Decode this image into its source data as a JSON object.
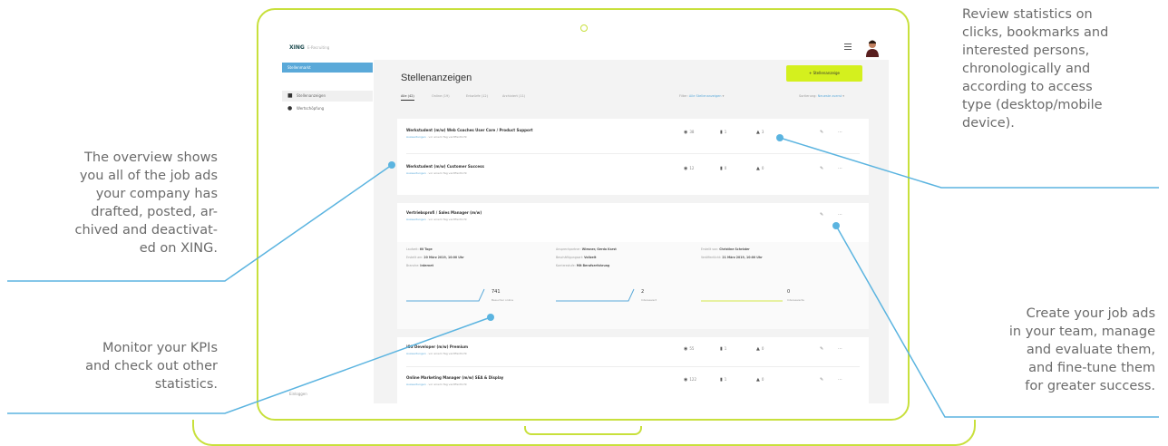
{
  "callouts": {
    "overview": [
      "The overview shows",
      "you all of the job ads",
      "your company has",
      "drafted, posted, ar-",
      "chived and deactivat-",
      "ed on XING."
    ],
    "kpis": [
      "Monitor your KPIs",
      "and check out other",
      "statistics."
    ],
    "statistics": [
      "Review statistics on",
      "clicks, bookmarks and",
      "interested persons,",
      "chronologically and",
      "according to access",
      "type (desktop/mobile",
      "device)."
    ],
    "create": [
      "Create your job ads",
      "in your team, manage",
      "and evaluate them,",
      "and fine-tune them",
      "for greater success."
    ]
  },
  "app": {
    "logo": "XING",
    "logo_sub": "E-Recruiting",
    "page_title": "Stellenanzeigen",
    "post_button": "+ Stellenanzeige",
    "sidebar": {
      "header": "Stellenmarkt",
      "items": [
        {
          "label": "Stellenanzeigen",
          "icon": "briefcase-icon"
        },
        {
          "label": "Wertschöpfung",
          "icon": "gear-icon"
        }
      ],
      "bottom": "Einloggen"
    },
    "tabs": [
      "Alle (42)",
      "Online (19)",
      "Entwürfe (12)",
      "Archiviert (11)"
    ],
    "filter_label": "Filter:",
    "filter_value": "Alle Stellenanzeigen",
    "sort_label": "Sortierung:",
    "sort_value": "Neueste zuerst",
    "jobs_top": [
      {
        "title": "Werkstudent (m/w) Web Coaches User Care / Product Support",
        "sub_link": "Auswertungen",
        "sub": " · vor einem Tag veröffentlicht",
        "views": "38",
        "bookmarks": "1",
        "interested": "3"
      },
      {
        "title": "Werkstudent (m/w) Customer Success",
        "sub_link": "Auswertungen",
        "sub": " · vor einem Tag veröffentlicht",
        "views": "12",
        "bookmarks": "0",
        "interested": "0"
      }
    ],
    "expanded_job": {
      "title": "Vertriebsprofi / Sales Manager (m/w)",
      "sub_link": "Auswertungen",
      "sub": " · vor einem Tag veröffentlicht",
      "details": [
        {
          "label": "Laufzeit:",
          "value": "60 Tage"
        },
        {
          "label": "Ansprechpartner:",
          "value": "Wiesner, Gerda Karst"
        },
        {
          "label": "Erstellt von:",
          "value": "Christine Schröder"
        },
        {
          "label": "Erstellt am:",
          "value": "20 März 2019, 10:00 Uhr"
        },
        {
          "label": "Beschäftigungsart:",
          "value": "Vollzeit"
        },
        {
          "label": "Veröffentlicht:",
          "value": "21 März 2019, 10:00 Uhr"
        },
        {
          "label": "Branche:",
          "value": "Internet"
        },
        {
          "label": "Karrierestufe:",
          "value": "Mit Berufserfahrung"
        }
      ],
      "kpis": [
        {
          "value": "741",
          "label": "Besucher online"
        },
        {
          "value": "2",
          "label": "Interessiert"
        },
        {
          "value": "0",
          "label": "Interessierte"
        }
      ]
    },
    "jobs_bottom": [
      {
        "title": "iOS Developer (m/w) Premium",
        "sub_link": "Auswertungen",
        "sub": " · vor einem Tag veröffentlicht",
        "views": "55",
        "bookmarks": "1",
        "interested": "0"
      },
      {
        "title": "Online Marketing Manager (m/w) SEA & Display",
        "sub_link": "Auswertungen",
        "sub": " · vor einem Tag veröffentlicht",
        "views": "122",
        "bookmarks": "1",
        "interested": "0"
      }
    ]
  },
  "colors": {
    "accent_lime": "#c8e03c",
    "button_lime": "#d4f01e",
    "line_blue": "#5bb4e0",
    "link_blue": "#5aa9d9",
    "text_grey": "#6b6b6b"
  }
}
